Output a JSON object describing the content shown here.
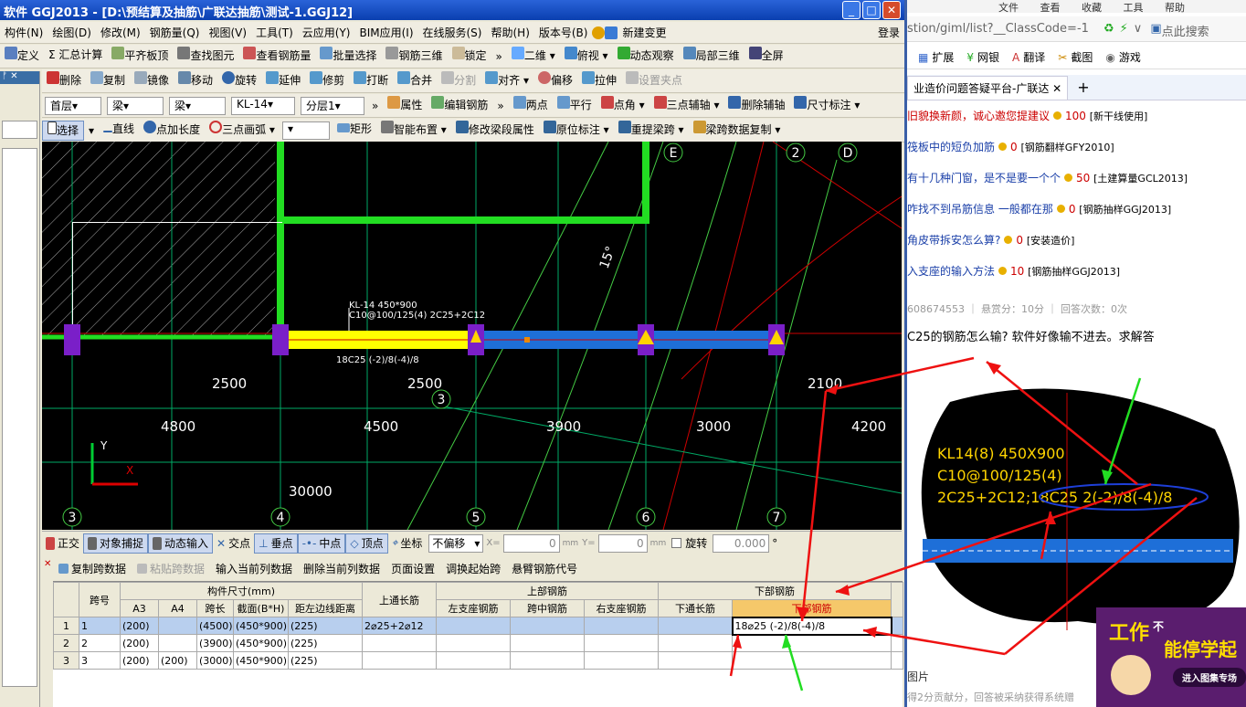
{
  "window": {
    "title": "软件 GGJ2013 - [D:\\预结算及抽筋\\广联达抽筋\\测试-1.GGJ12]"
  },
  "menu": [
    "构件(N)",
    "绘图(D)",
    "修改(M)",
    "钢筋量(Q)",
    "视图(V)",
    "工具(T)",
    "云应用(Y)",
    "BIM应用(I)",
    "在线服务(S)",
    "帮助(H)",
    "版本号(B)",
    "新建变更"
  ],
  "menu_login": "登录",
  "toolbar1": [
    "定义",
    "Σ 汇总计算",
    "平齐板顶",
    "查找图元",
    "查看钢筋量",
    "批量选择",
    "钢筋三维",
    "锁定",
    "二维",
    "俯视",
    "动态观察",
    "局部三维",
    "全屏"
  ],
  "toolbar2": [
    "删除",
    "复制",
    "镜像",
    "移动",
    "旋转",
    "延伸",
    "修剪",
    "打断",
    "合并",
    "分割",
    "对齐",
    "偏移",
    "拉伸",
    "设置夹点"
  ],
  "selectors": {
    "floor": "首层",
    "type1": "梁",
    "type2": "梁",
    "member": "KL-14",
    "layer": "分层1"
  },
  "toolbar3_right": [
    "属性",
    "编辑钢筋",
    "两点",
    "平行",
    "点角",
    "三点辅轴",
    "删除辅轴",
    "尺寸标注"
  ],
  "toolbar4": [
    "选择",
    "直线",
    "点加长度",
    "三点画弧",
    "矩形",
    "智能布置",
    "修改梁段属性",
    "原位标注",
    "重提梁跨",
    "梁跨数据复制"
  ],
  "canvas": {
    "beam_label1": "KL-14 450*900",
    "beam_label2": "C10@100/125(4) 2C25+2C12",
    "beam_bottom_label": "18C25 (-2)/8(-4)/8",
    "angle": "15°",
    "dims_top": [
      "2500",
      "2500",
      "2100"
    ],
    "dims_mid": [
      "4800",
      "4500",
      "3900",
      "3000",
      "4200"
    ],
    "total": "30000",
    "axes_bottom": [
      "3",
      "4",
      "5",
      "6",
      "7"
    ],
    "axes_top": [
      "E",
      "2",
      "D"
    ],
    "axis_mid": "3",
    "y_label": "Y",
    "x_label": "X"
  },
  "statusbar": [
    "正交",
    "对象捕捉",
    "动态输入",
    "交点",
    "垂点",
    "中点",
    "顶点",
    "坐标",
    "不偏移",
    "X=",
    "0",
    "mm",
    "Y=",
    "0",
    "mm",
    "旋转",
    "0.000",
    "°"
  ],
  "gridtools": [
    "复制跨数据",
    "粘贴跨数据",
    "输入当前列数据",
    "删除当前列数据",
    "页面设置",
    "调换起始跨",
    "悬臂钢筋代号"
  ],
  "grid": {
    "headers_top": {
      "span": "跨号",
      "size": "构件尺寸(mm)",
      "top_through": "上通长筋",
      "top_rebar": "上部钢筋",
      "bottom_rebar": "下部钢筋"
    },
    "headers_sub": [
      "A3",
      "A4",
      "跨长",
      "截面(B*H)",
      "距左边线距离",
      "左支座钢筋",
      "跨中钢筋",
      "右支座钢筋",
      "下通长筋",
      "下部钢筋"
    ],
    "rows": [
      {
        "n": "1",
        "span": "1",
        "a3": "(200)",
        "a4": "",
        "len": "(4500)",
        "sec": "(450*900)",
        "dist": "(225)",
        "top": "2⌀25+2⌀12",
        "bottom": "18⌀25 (-2)/8(-4)/8"
      },
      {
        "n": "2",
        "span": "2",
        "a3": "(200)",
        "a4": "",
        "len": "(3900)",
        "sec": "(450*900)",
        "dist": "(225)",
        "top": "",
        "bottom": ""
      },
      {
        "n": "3",
        "span": "3",
        "a3": "(200)",
        "a4": "(200)",
        "len": "(3000)",
        "sec": "(450*900)",
        "dist": "(225)",
        "top": "",
        "bottom": ""
      }
    ]
  },
  "browser": {
    "url": "stion/giml/list?__ClassCode=-1",
    "search": "点此搜索",
    "menu_items": [
      "文件",
      "查看",
      "收藏",
      "工具",
      "帮助"
    ],
    "toolbar": [
      "扩展",
      "网银",
      "翻译",
      "截图",
      "游戏"
    ],
    "tab": "业造价问题答疑平台-广联达",
    "questions": [
      {
        "title": "旧貌换新颜，诚心邀您提建议",
        "score": "100",
        "tag": "[新干线使用]"
      },
      {
        "title": "筏板中的短负加筋",
        "score": "0",
        "tag": "[钢筋翻样GFY2010]"
      },
      {
        "title": "有十几种门窗，是不是要一个个",
        "score": "50",
        "tag": "[土建算量GCL2013]"
      },
      {
        "title": "咋找不到吊筋信息 一般都在那",
        "score": "0",
        "tag": "[钢筋抽样GGJ2013]"
      },
      {
        "title": "角皮带拆安怎么算?",
        "score": "0",
        "tag": "[安装造价]"
      },
      {
        "title": "入支座的输入方法",
        "score": "10",
        "tag": "[钢筋抽样GGJ2013]"
      }
    ],
    "meta": "608674553  ｜ 悬赏分：10分  ｜ 回答次数：0次",
    "question_body": "C25的钢筋怎么输? 软件好像输不进去。求解答",
    "annot_lines": [
      "KL14(8) 450X900",
      "C10@100/125(4)",
      "2C25+2C12;18C25 2(-2)/8(-4)/8"
    ],
    "footer1": "图片",
    "footer2": "得2分贡献分，回答被采纳获得系统赠",
    "ad1": "工作",
    "ad2": "不",
    "ad3": "能停学起",
    "ad4": "进入图集专场"
  }
}
